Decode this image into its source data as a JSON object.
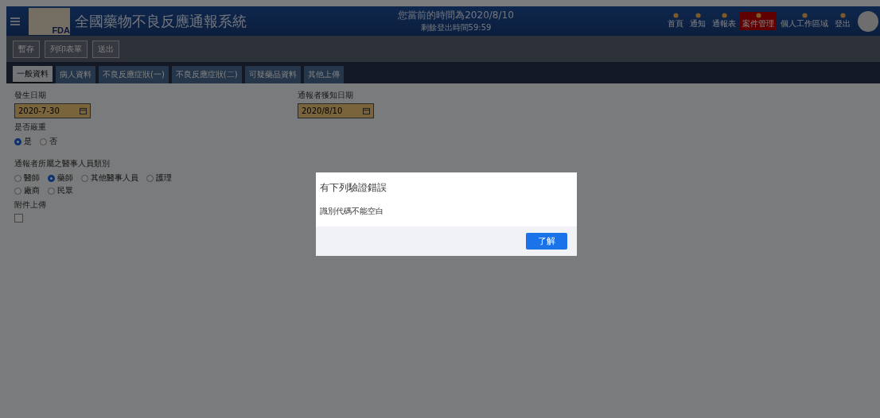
{
  "header": {
    "logo_text": "FDA",
    "title": "全國藥物不良反應通報系統",
    "date_line": "您當前的時間為2020/8/10",
    "session_line": "剩餘登出時間59:59",
    "nav": [
      {
        "label": "首頁",
        "selected": false
      },
      {
        "label": "通知",
        "selected": false
      },
      {
        "label": "通報表",
        "selected": false
      },
      {
        "label": "案件管理",
        "selected": true
      },
      {
        "label": "個人工作區域",
        "selected": false
      },
      {
        "label": "登出",
        "selected": false
      }
    ]
  },
  "toolbar": [
    "暫存",
    "列印表單",
    "送出"
  ],
  "tabs": [
    {
      "label": "一般資料",
      "selected": true
    },
    {
      "label": "病人資料",
      "selected": false
    },
    {
      "label": "不良反應症狀(一)",
      "selected": false
    },
    {
      "label": "不良反應症狀(二)",
      "selected": false
    },
    {
      "label": "可疑藥品資料",
      "selected": false
    },
    {
      "label": "其他上傳",
      "selected": false
    }
  ],
  "form": {
    "occurred_date": {
      "label": "發生日期",
      "value": "2020-7-30"
    },
    "known_date": {
      "label": "通報者獲知日期",
      "value": "2020/8/10"
    },
    "serious": {
      "label": "是否嚴重",
      "options": [
        {
          "label": "是",
          "selected": true
        },
        {
          "label": "否",
          "selected": false
        }
      ]
    },
    "reporter": {
      "label": "通報者所屬之醫事人員類別",
      "options": [
        {
          "label": "醫師",
          "selected": false
        },
        {
          "label": "藥師",
          "selected": true
        },
        {
          "label": "其他醫事人員",
          "selected": false
        },
        {
          "label": "護理",
          "selected": false
        },
        {
          "label": "廠商",
          "selected": false
        },
        {
          "label": "民眾",
          "selected": false
        }
      ]
    },
    "attachment": {
      "label": "附件上傳",
      "checked": false
    }
  },
  "dialog": {
    "title": "有下列驗證錯誤",
    "message": "識別代碼不能空白",
    "button": "了解"
  }
}
